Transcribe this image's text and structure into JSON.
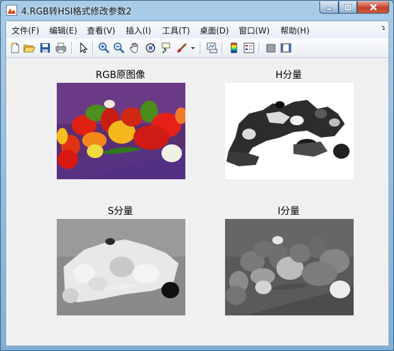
{
  "window": {
    "title": "4.RGB转HSI格式修改参数2",
    "app_icon": "matlab-figure-icon"
  },
  "caption_buttons": {
    "minimize": "minimize-icon",
    "maximize": "maximize-icon",
    "close": "close-icon"
  },
  "menu": [
    {
      "label": "文件(F)"
    },
    {
      "label": "编辑(E)"
    },
    {
      "label": "查看(V)"
    },
    {
      "label": "插入(I)"
    },
    {
      "label": "工具(T)"
    },
    {
      "label": "桌面(D)"
    },
    {
      "label": "窗口(W)"
    },
    {
      "label": "帮助(H)"
    }
  ],
  "toolbar": [
    "new-figure-icon",
    "open-file-icon",
    "save-icon",
    "print-icon",
    "edit-plot-pointer-icon",
    "zoom-in-icon",
    "zoom-out-icon",
    "pan-hand-icon",
    "rotate-3d-icon",
    "data-cursor-icon",
    "brush-icon",
    "dropdown-arrow-icon",
    "link-plot-icon",
    "colorbar-icon",
    "legend-icon",
    "hide-plot-tools-icon",
    "show-plot-tools-icon"
  ],
  "subplots": [
    {
      "title": "RGB原图像",
      "kind": "color"
    },
    {
      "title": "H分量",
      "kind": "hue"
    },
    {
      "title": "S分量",
      "kind": "saturation"
    },
    {
      "title": "I分量",
      "kind": "intensity"
    }
  ],
  "colors": {
    "close_button": "#c4402c",
    "client_bg": "#f0f0f0",
    "frame": "#7fb0d8"
  }
}
